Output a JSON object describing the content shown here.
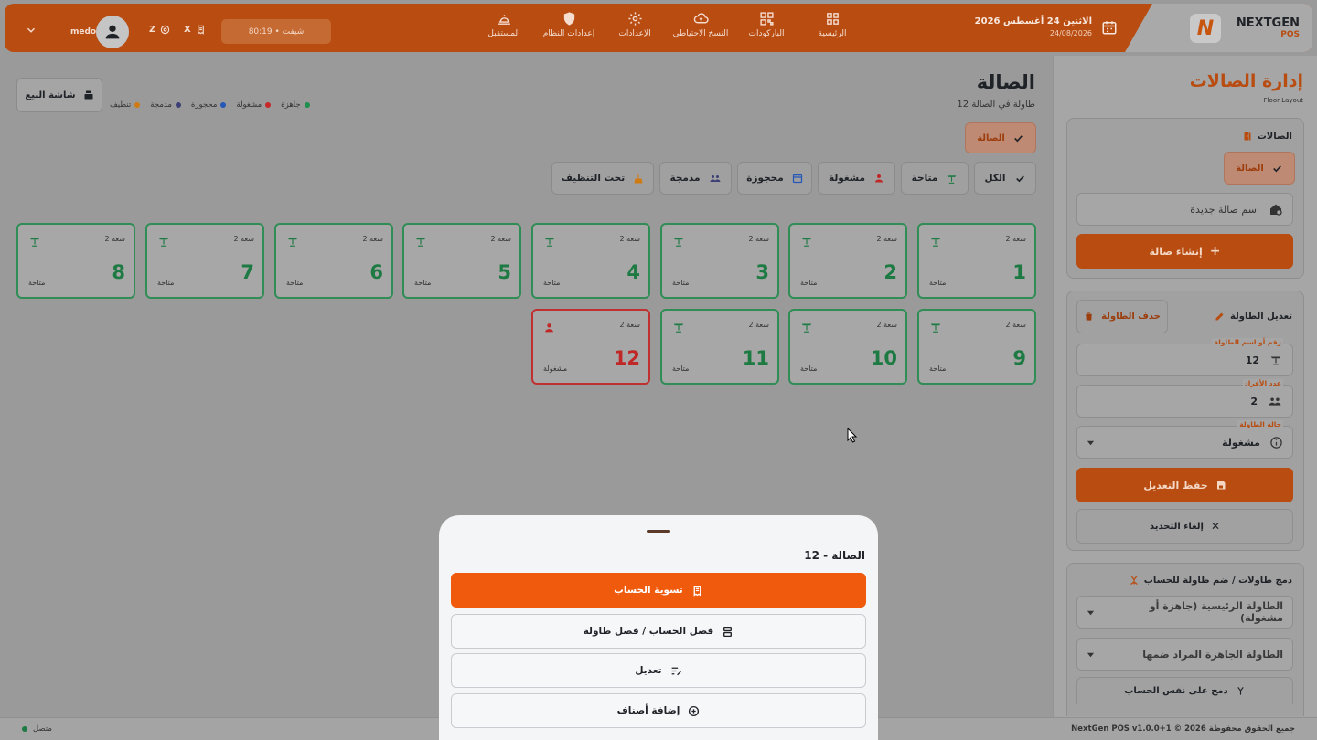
{
  "brand": {
    "name": "NEXTGEN",
    "sub": "POS",
    "logo_letter": "N"
  },
  "header": {
    "date_main": "الاثنين 24 أغسطس 2026",
    "date_sub": "24/08/2026",
    "nav": [
      {
        "label": "الرئيسية",
        "icon": "grid-icon"
      },
      {
        "label": "الباركودات",
        "icon": "qr-code-icon"
      },
      {
        "label": "النسخ الاحتياطي",
        "icon": "cloud-upload-icon"
      },
      {
        "label": "الإعدادات",
        "icon": "gear-icon"
      },
      {
        "label": "إعدادات النظام",
        "icon": "shield-icon"
      },
      {
        "label": "المستقبل",
        "icon": "cloche-icon"
      }
    ],
    "shift": "شيفت • 80:19",
    "x_label": "X",
    "z_label": "Z",
    "user": "medo"
  },
  "sidebar": {
    "title": "إدارة الصالات",
    "subtitle": "Floor Layout",
    "halls_header": "الصالات",
    "active_hall": "الصالة",
    "new_hall_placeholder": "اسم صالة جديدة",
    "create_hall": "إنشاء صالة",
    "edit_table_header": "تعديل الطاولة",
    "delete_table": "حذف الطاولة",
    "table_name_label": "رقم أو اسم الطاولة",
    "table_name_value": "12",
    "guests_label": "عدد الأفراد",
    "guests_value": "2",
    "status_label": "حالة الطاولة",
    "status_value": "مشغولة",
    "save_edit": "حفظ التعديل",
    "cancel_select": "إلغاء التحديد",
    "merge_header": "دمج طاولات / ضم طاولة للحساب",
    "main_table_placeholder": "الطاولة الرئيسية (جاهزة أو مشغولة)",
    "join_table_placeholder": "الطاولة الجاهزة المراد ضمها",
    "merge_same_bill": "دمج على نفس الحساب"
  },
  "main": {
    "title": "الصالة",
    "subtitle": "12 طاولة في الصالة",
    "hall_chip": "الصالة",
    "sale_screen": "شاشة البيع",
    "legend": [
      {
        "label": "جاهزة",
        "color": "#1f8f4e"
      },
      {
        "label": "مشغولة",
        "color": "#c62828"
      },
      {
        "label": "محجوزة",
        "color": "#2457b8"
      },
      {
        "label": "مدمجة",
        "color": "#3c3f76"
      },
      {
        "label": "تنظيف",
        "color": "#d07a12"
      }
    ],
    "filters": [
      {
        "label": "الكل",
        "icon": "check-icon"
      },
      {
        "label": "متاحة",
        "icon": "table-icon"
      },
      {
        "label": "مشغولة",
        "icon": "person-icon"
      },
      {
        "label": "محجوزة",
        "icon": "calendar-icon"
      },
      {
        "label": "مدمجة",
        "icon": "group-icon"
      },
      {
        "label": "تحت التنظيف",
        "icon": "broom-icon"
      }
    ],
    "tables": [
      {
        "num": "1",
        "cap": "سعة 2",
        "status": "متاحة"
      },
      {
        "num": "2",
        "cap": "سعة 2",
        "status": "متاحة"
      },
      {
        "num": "3",
        "cap": "سعة 2",
        "status": "متاحة"
      },
      {
        "num": "4",
        "cap": "سعة 2",
        "status": "متاحة"
      },
      {
        "num": "5",
        "cap": "سعة 2",
        "status": "متاحة"
      },
      {
        "num": "6",
        "cap": "سعة 2",
        "status": "متاحة"
      },
      {
        "num": "7",
        "cap": "سعة 2",
        "status": "متاحة"
      },
      {
        "num": "8",
        "cap": "سعة 2",
        "status": "متاحة"
      },
      {
        "num": "9",
        "cap": "سعة 2",
        "status": "متاحة"
      },
      {
        "num": "10",
        "cap": "سعة 2",
        "status": "متاحة"
      },
      {
        "num": "11",
        "cap": "سعة 2",
        "status": "متاحة"
      },
      {
        "num": "12",
        "cap": "سعة 2",
        "status": "مشغولة"
      }
    ]
  },
  "sheet": {
    "title": "الصالة - 12",
    "actions": [
      "تسوية الحساب",
      "فصل الحساب / فصل طاولة",
      "تعديل",
      "إضافة أصناف"
    ]
  },
  "footer": {
    "copyright": "NextGen POS v1.0.0+1 © 2026 جميع الحقوق محفوظة",
    "status": "متصل"
  },
  "colors": {
    "accent": "#b84c11",
    "primary_button": "#f05a0c",
    "available": "#1d7a42",
    "occupied": "#c02828"
  }
}
